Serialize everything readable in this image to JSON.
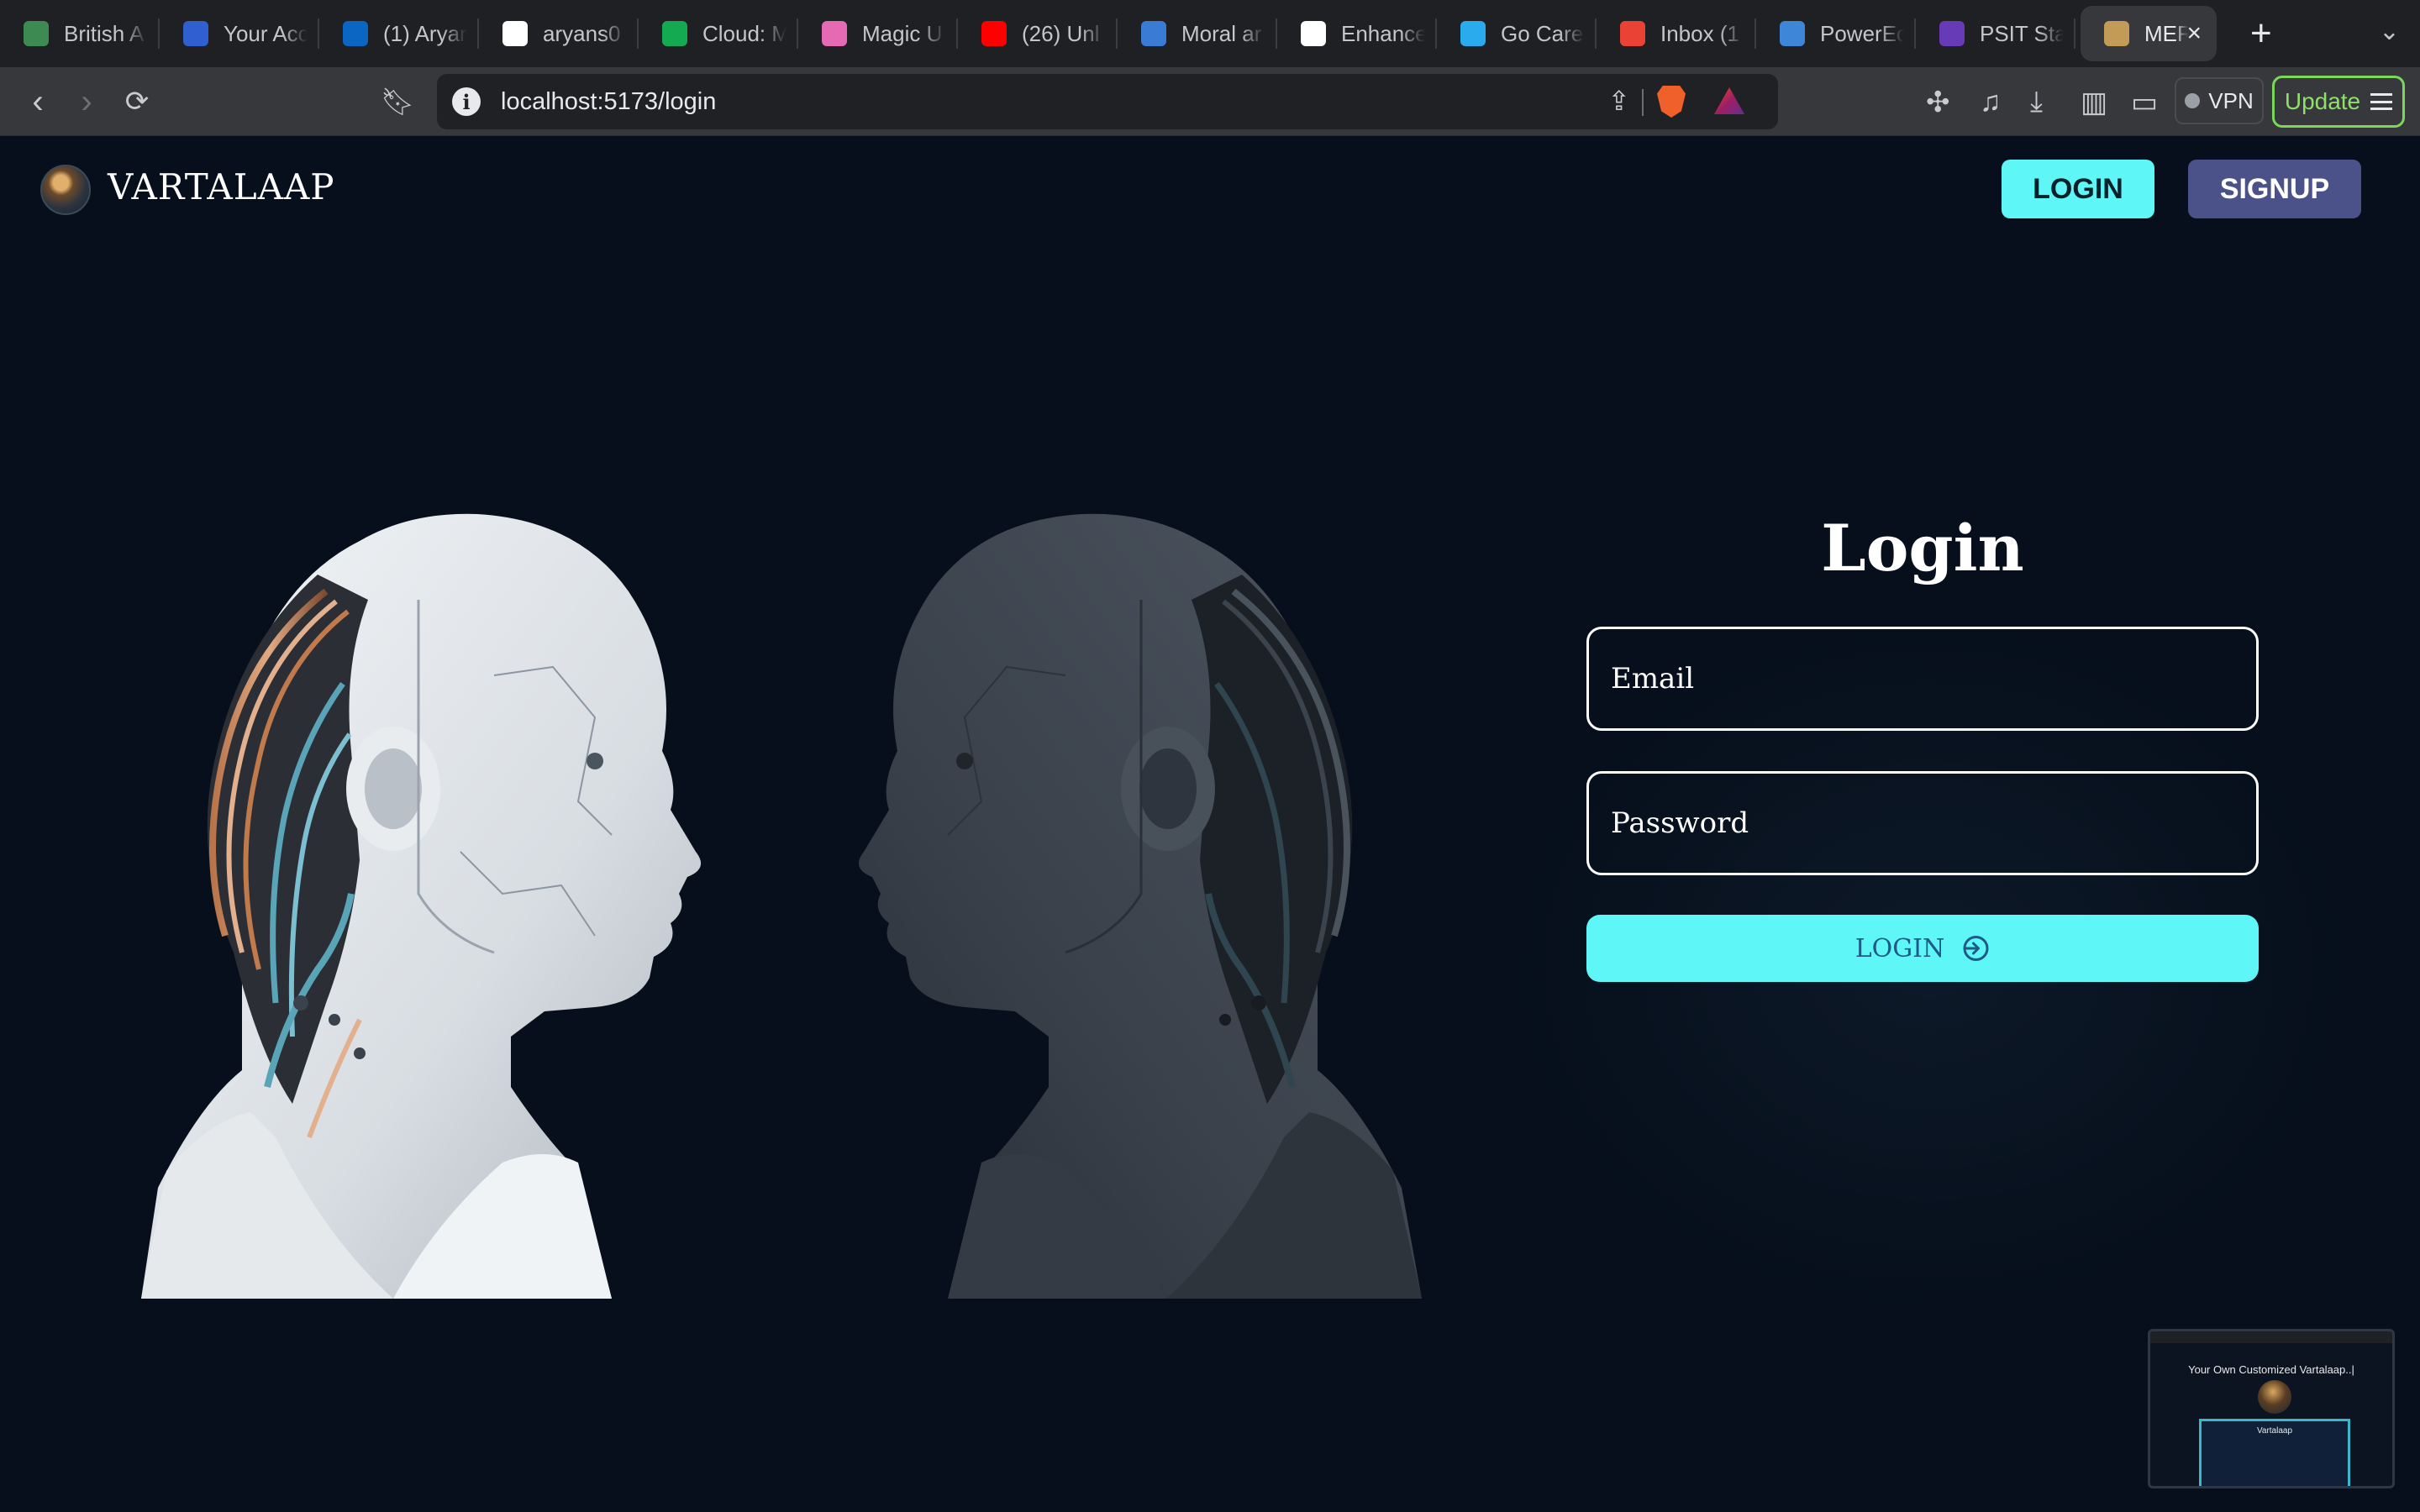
{
  "browser": {
    "tabs": [
      {
        "title": "British A",
        "icon": "british-airways-icon",
        "color": "#3d8a52"
      },
      {
        "title": "Your Acc",
        "icon": "shield-check-icon",
        "color": "#2f5fd0"
      },
      {
        "title": "(1) Aryan",
        "icon": "linkedin-icon",
        "color": "#0a66c2"
      },
      {
        "title": "aryans0",
        "icon": "github-icon",
        "color": "#ffffff"
      },
      {
        "title": "Cloud: M",
        "icon": "mongodb-leaf-icon",
        "color": "#13aa52"
      },
      {
        "title": "Magic U",
        "icon": "magic-ui-icon",
        "color": "#e56ab3"
      },
      {
        "title": "(26) Unl",
        "icon": "youtube-icon",
        "color": "#ff0000"
      },
      {
        "title": "Moral ar",
        "icon": "video-play-icon",
        "color": "#3a7bd5"
      },
      {
        "title": "Enhance",
        "icon": "openai-icon",
        "color": "#ffffff"
      },
      {
        "title": "Go Care",
        "icon": "telegram-icon",
        "color": "#2aabee"
      },
      {
        "title": "Inbox (1",
        "icon": "gmail-icon",
        "color": "#ea4335"
      },
      {
        "title": "PowerEd",
        "icon": "poweredu-icon",
        "color": "#3d86d8"
      },
      {
        "title": "PSIT Sta",
        "icon": "form-icon",
        "color": "#673ab7"
      },
      {
        "title": "MER",
        "icon": "vartalaap-favicon",
        "color": "#c49a57",
        "active": true
      }
    ],
    "new_tab_label": "+",
    "url": "localhost:5173/login",
    "vpn_label": "VPN",
    "update_label": "Update"
  },
  "header": {
    "brand": "VARTALAAP",
    "login_label": "LOGIN",
    "signup_label": "SIGNUP"
  },
  "login_form": {
    "title": "Login",
    "email_placeholder": "Email",
    "password_placeholder": "Password",
    "submit_label": "LOGIN"
  },
  "pip_preview": {
    "headline": "Your Own Customized Vartalaap..|",
    "window_title": "Vartalaap"
  },
  "colors": {
    "page_background": "#060f1b",
    "accent_cyan": "#5ff6f8",
    "signup_purple": "#4a5289"
  }
}
